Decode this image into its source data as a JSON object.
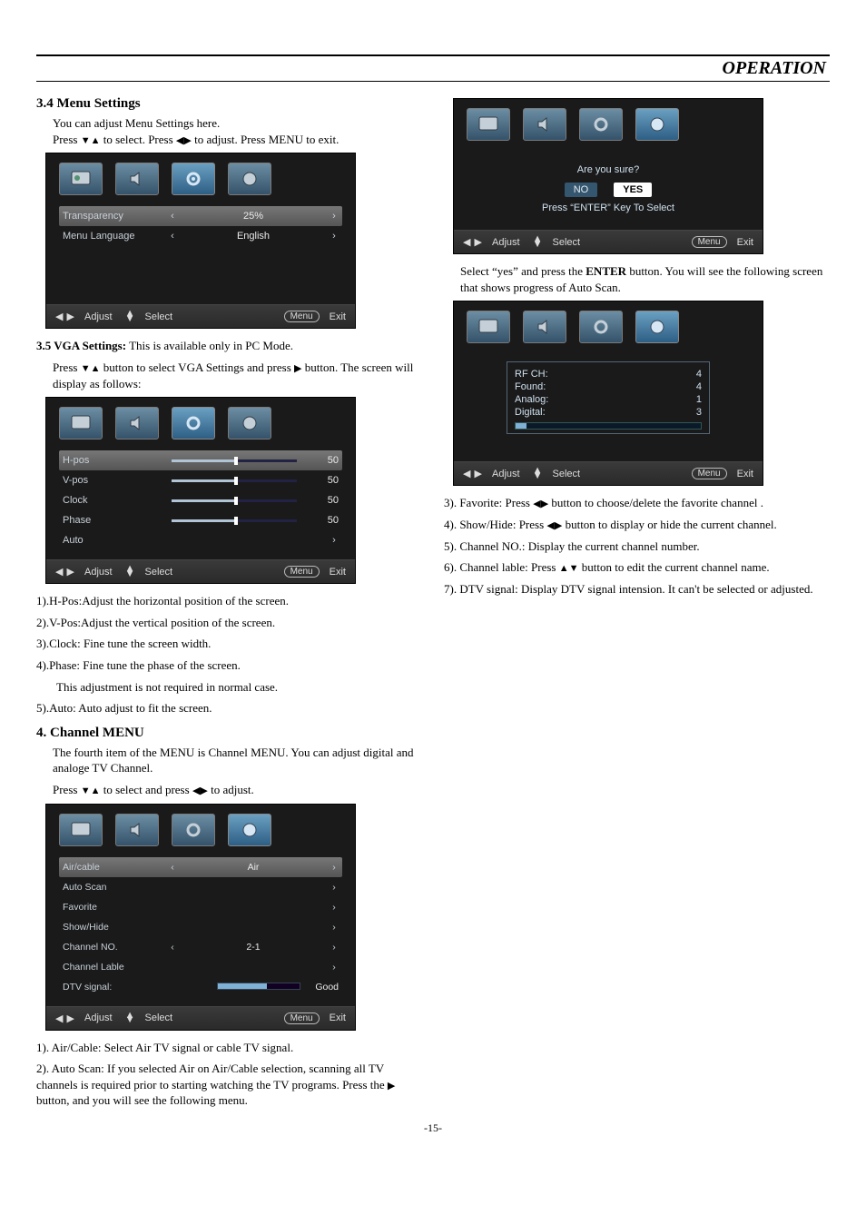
{
  "header_title": "OPERATION",
  "pageNumber": "-15-",
  "s34": {
    "heading": "3.4  Menu Settings",
    "line1": "You can adjust Menu Settings here.",
    "line2a": "Press ",
    "line2b": " to select. Press ",
    "line2c": " to adjust. Press MENU to exit."
  },
  "osd1": {
    "r1_label": "Transparency",
    "r1_val": "25%",
    "r2_label": "Menu Language",
    "r2_val": "English",
    "footer_adjust": "Adjust",
    "footer_select": "Select",
    "footer_menu": "Menu",
    "footer_exit": "Exit"
  },
  "s35": {
    "heading_a": "3.5  VGA Settings:",
    "heading_b": "  This is available only in PC Mode.",
    "p1a": "Press ",
    "p1b": " button to select  VGA Settings and press ",
    "p1c": " button. The screen will  display as follows:"
  },
  "osd2": {
    "r1": "H-pos",
    "v1": "50",
    "r2": "V-pos",
    "v2": "50",
    "r3": "Clock",
    "v3": "50",
    "r4": "Phase",
    "v4": "50",
    "r5": "Auto",
    "footer_adjust": "Adjust",
    "footer_select": "Select",
    "footer_menu": "Menu",
    "footer_exit": "Exit"
  },
  "vga_list": {
    "i1": "1).H-Pos:Adjust the horizontal position of the screen.",
    "i2": "2).V-Pos:Adjust the vertical position of the screen.",
    "i3": "3).Clock: Fine tune the screen width.",
    "i4": "4).Phase: Fine tune the phase of  the screen.",
    "i4b": "This adjustment is not required in normal case.",
    "i5": "5).Auto: Auto adjust to fit the screen."
  },
  "s4": {
    "heading": "4. Channel  MENU",
    "p1": "The fourth item of the MENU is Channel MENU. You can adjust digital and analoge TV Channel.",
    "p2a": "Press ",
    "p2b": "  to select and press ",
    "p2c": " to adjust."
  },
  "osd3": {
    "r1": "Air/cable",
    "v1": "Air",
    "r2": "Auto  Scan",
    "r3": "Favorite",
    "r4": "Show/Hide",
    "r5": "Channel NO.",
    "v5": "2-1",
    "r6": "Channel Lable",
    "r7": "DTV signal:",
    "v7": "Good",
    "footer_adjust": "Adjust",
    "footer_select": "Select",
    "footer_menu": "Menu",
    "footer_exit": "Exit"
  },
  "below_osd3": {
    "p1": "1). Air/Cable: Select Air  TV signal or cable  TV signal.",
    "p2a": "2). Auto Scan: If you selected Air on Air/Cable selection, scanning all TV channels is required prior to starting watching the TV programs. Press the ",
    "p2b": " button, and you will see the following menu."
  },
  "osd4": {
    "q": "Are you sure?",
    "no": "NO",
    "yes": "YES",
    "hint": "Press “ENTER” Key To Select",
    "footer_adjust": "Adjust",
    "footer_select": "Select",
    "footer_menu": "Menu",
    "footer_exit": "Exit"
  },
  "after_osd4": {
    "pa": "Select “yes” and press the  ",
    "enter": "ENTER",
    "pb": "  button. You will see the following screen that shows progress of Auto Scan."
  },
  "osd5": {
    "l1": "RF  CH:",
    "v1": "4",
    "l2": "Found:",
    "v2": "4",
    "l3": "Analog:",
    "v3": "1",
    "l4": "Digital:",
    "v4": "3",
    "footer_adjust": "Adjust",
    "footer_select": "Select",
    "footer_menu": "Menu",
    "footer_exit": "Exit"
  },
  "right_list": {
    "i3a": "3). Favorite: Press ",
    "i3b": " button to choose/delete the favorite channel .",
    "i4a": "4). Show/Hide: Press ",
    "i4b": " button to display or hide the current channel.",
    "i5": "5). Channel NO.: Display the current channel number.",
    "i6a": "6). Channel lable: Press ",
    "i6b": " button to edit the current channel name.",
    "i7": "7). DTV signal: Display DTV signal intension. It can't be selected or adjusted."
  },
  "icons": {
    "down": "▼",
    "up": "▲",
    "left": "◀",
    "right": "▶",
    "leftS": "‹",
    "rightS": "›"
  }
}
